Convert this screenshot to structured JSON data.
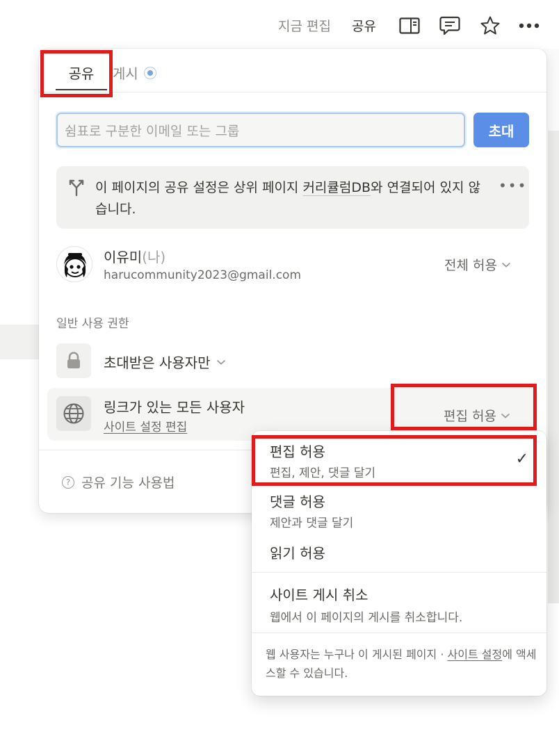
{
  "topbar": {
    "edit_label": "지금 편집",
    "share_label": "공유",
    "icons": [
      "panel-icon",
      "comment-icon",
      "star-icon",
      "more-icon"
    ]
  },
  "panel": {
    "tabs": {
      "share": "공유",
      "publish": "게시"
    },
    "invite": {
      "placeholder": "쉼표로 구분한 이메일 또는 그룹",
      "button": "초대"
    },
    "notice": {
      "text_before": "이 페이지의 공유 설정은 상위 페이지 ",
      "link": "커리큘럼DB",
      "text_after": "와 연결되어 있지 않습니다.",
      "more": "•••"
    },
    "user": {
      "name": "이유미",
      "me_tag": "(나)",
      "email": "harucommunity2023@gmail.com",
      "permission": "전체 허용"
    },
    "section_label": "일반 사용 권한",
    "access": {
      "label": "초대받은 사용자만"
    },
    "link_access": {
      "title": "링크가 있는 모든 사용자",
      "sub": "사이트 설정 편집",
      "permission": "편집 허용"
    },
    "help": "공유 기능 사용법"
  },
  "menu": {
    "items": [
      {
        "title": "편집 허용",
        "sub": "편집, 제안, 댓글 달기",
        "selected": true
      },
      {
        "title": "댓글 허용",
        "sub": "제안과 댓글 달기"
      },
      {
        "title": "읽기 허용"
      },
      {
        "title": "사이트 게시 취소",
        "sub": "웹에서 이 페이지의 게시를 취소합니다."
      }
    ],
    "check": "✓",
    "footer": {
      "before": "웹 사용자는 누구나 이 게시된 페이지 · ",
      "link": "사이트 설정",
      "after": "에 액세스할 수 있습니다."
    }
  },
  "colors": {
    "accent": "#5b8ee6",
    "highlight": "#e01b1b",
    "text": "#37352f",
    "muted": "#6b6a66"
  }
}
